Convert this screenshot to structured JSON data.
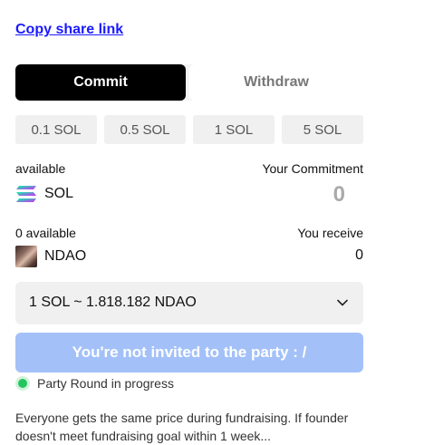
{
  "share": {
    "link_label": "Copy share link"
  },
  "tabs": {
    "commit": "Commit",
    "withdraw": "Withdraw"
  },
  "amount_options": [
    "0.1 SOL",
    "0.5 SOL",
    "1 SOL",
    "5 SOL"
  ],
  "commit_section": {
    "available_label": "available",
    "your_commitment_label": "Your Commitment",
    "token": "SOL",
    "commitment_value": "0"
  },
  "receive_section": {
    "available_label": "0 available",
    "you_receive_label": "You receive",
    "token": "NDAO",
    "receive_value": "0"
  },
  "rate": {
    "text": "1 SOL ~ 1.818.182 NDAO"
  },
  "cta": {
    "label": "You're not invited to the party : /",
    "color": "#a3c1f8"
  },
  "status": {
    "text": "Party Round in progress",
    "color": "#22c55e"
  },
  "description": {
    "text": "Everyone gets the same price during fundraising. If founder doesn't meet fundraising goal within 1 week..."
  }
}
